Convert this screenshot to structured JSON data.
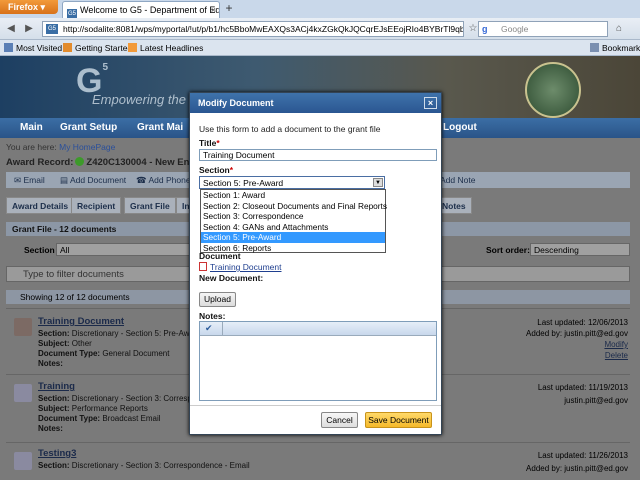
{
  "browser": {
    "menu_label": "Firefox",
    "tab_title": "Welcome to G5 - Department of Educati...",
    "tab_close": "×",
    "new_tab": "+",
    "url": "http://sodalite:8081/wps/myportal/!ut/p/b1/hc5BboMwEAXQs3ACj4kxZGkQkJQCqrEJsEEojRIo4BYBrTl9qbqhOrsvv",
    "search_placeholder": "Google",
    "bookmarks": [
      "Most Visited",
      "Getting Started",
      "Latest Headlines"
    ],
    "bookmarks_right": "Bookmarks"
  },
  "page": {
    "logo": "G",
    "logo_sup": "5",
    "tagline": "Empowering the g",
    "nav": [
      "Main",
      "Grant Setup",
      "Grant Mai",
      "Logout"
    ],
    "you_are_here": "You are here:",
    "breadcrumb": "My HomePage",
    "award_label": "Award Record:",
    "award_value": "Z420C130004 - New England",
    "actions": [
      "Email",
      "Add Document",
      "Add Phone",
      "Add Note"
    ],
    "subtabs": [
      "Award Details",
      "Recipient",
      "Grant File",
      "In",
      "Notes"
    ],
    "grant_file_header": "Grant File - 12 documents",
    "section_label": "Section",
    "section_value": "All",
    "sort_label": "Sort order:",
    "sort_value": "Descending",
    "filter_placeholder": "Type to filter documents",
    "showing": "Showing 12 of 12 documents",
    "docs": [
      {
        "title": "Training Document",
        "section": "Discretionary - Section 5: Pre-Awa",
        "subject": "Other",
        "doc_type": "General Document",
        "notes": "",
        "updated": "Last updated: 12/06/2013",
        "added_by": "Added by: justin.pitt@ed.gov",
        "modify": "Modify",
        "delete": "Delete"
      },
      {
        "title": "Training",
        "section": "Discretionary - Section 3: Correspo",
        "subject": "Performance Reports",
        "doc_type": "Broadcast Email",
        "notes": "",
        "updated": "Last updated: 11/19/2013",
        "added_by": "justin.pitt@ed.gov"
      },
      {
        "title": "Testing3",
        "section": "Discretionary - Section 3: Correspondence - Email",
        "updated": "Last updated: 11/26/2013",
        "added_by": "Added by: justin.pitt@ed.gov"
      }
    ],
    "field_labels": {
      "section": "Section:",
      "subject": "Subject:",
      "doc_type": "Document Type:",
      "notes": "Notes:"
    }
  },
  "modal": {
    "title": "Modify Document",
    "close": "×",
    "intro": "Use this form to add a document to the grant file",
    "title_label": "Title",
    "title_value": "Training Document",
    "section_label": "Section",
    "section_value": "Section 5: Pre-Award",
    "section_options": [
      "Section 1: Award",
      "Section 2: Closeout Documents and Final Reports",
      "Section 3: Correspondence",
      "Section 4: GANs and Attachments",
      "Section 5: Pre-Award",
      "Section 6: Reports"
    ],
    "selected_option": 4,
    "document_label": "Document",
    "document_name": "Training Document",
    "new_document_label": "New Document:",
    "upload": "Upload",
    "notes_label": "Notes:",
    "cancel": "Cancel",
    "save": "Save Document",
    "required_mark": "*"
  }
}
